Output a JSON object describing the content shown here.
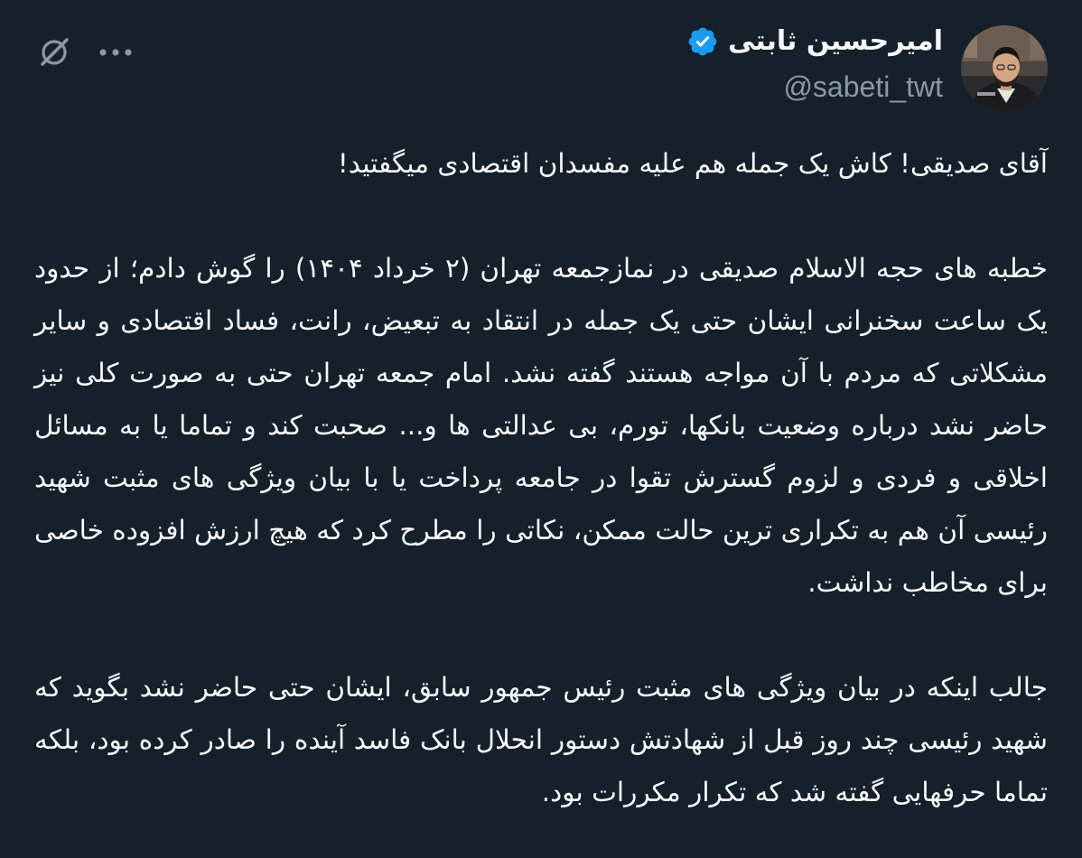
{
  "author": {
    "display_name": "امیرحسین ثابتی",
    "handle": "@sabeti_twt",
    "verified": true,
    "avatar_icon": "profile-photo"
  },
  "actions": {
    "more_icon": "more-horizontal-icon",
    "grok_icon": "grok-icon"
  },
  "colors": {
    "background": "#15202b",
    "text": "#f7f9f9",
    "secondary": "#8b98a5",
    "verified": "#1d9bf0"
  },
  "tweet": {
    "headline": "آقای صدیقی! کاش یک جمله هم علیه مفسدان اقتصادی میگفتید!",
    "paragraph_1": "خطبه های حجه الاسلام صدیقی در نمازجمعه تهران (۲ خرداد ۱۴۰۴) را گوش دادم؛ از حدود یک ساعت سخنرانی ایشان حتی یک جمله در انتقاد به تبعیض، رانت، فساد اقتصادی و سایر مشکلاتی که مردم با آن مواجه هستند گفته نشد. امام جمعه تهران حتی به صورت کلی نیز حاضر نشد درباره وضعیت بانکها، تورم، بی عدالتی ها و... صحبت کند و تماما یا به مسائل اخلاقی و فردی و لزوم گسترش تقوا در جامعه پرداخت یا با بیان ویژگی های مثبت شهید رئیسی آن هم به تکراری ترین حالت ممکن، نکاتی را مطرح کرد که هیچ ارزش افزوده خاصی برای مخاطب نداشت.",
    "paragraph_2": "جالب اینکه در بیان ویژگی های مثبت رئیس جمهور سابق، ایشان حتی حاضر نشد بگوید که شهید رئیسی چند روز قبل از شهادتش دستور انحلال بانک فاسد آینده را صادر کرده بود، بلکه تماما حرفهایی گفته شد که تکرار مکررات بود."
  }
}
